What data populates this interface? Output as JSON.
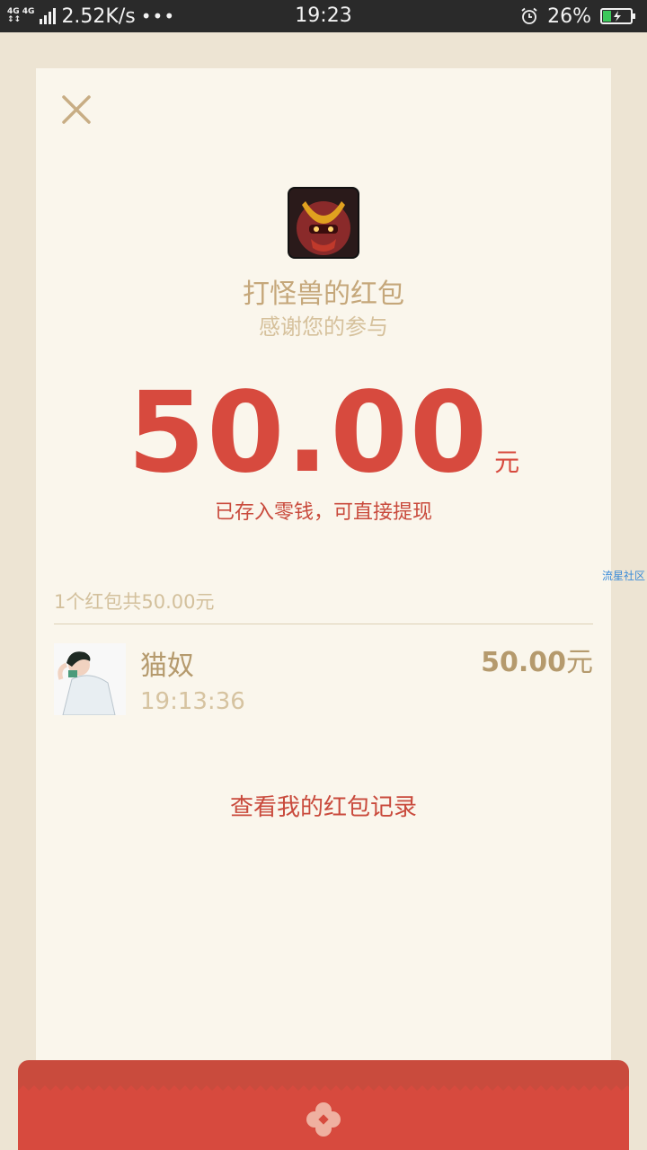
{
  "status_bar": {
    "network_type_top": "4G 4G",
    "network_type_bottom": "↕↕",
    "speed": "2.52K/s",
    "more": "•••",
    "time": "19:23",
    "battery": "26%",
    "icons": [
      "signal-icon",
      "alarm-icon",
      "battery-charging-icon"
    ]
  },
  "close": {
    "icon": "close-icon",
    "color": "#c8ad84"
  },
  "sender": {
    "title": "打怪兽的红包",
    "subtitle": "感谢您的参与"
  },
  "amount": {
    "value": "50.00",
    "unit": "元",
    "note": "已存入零钱，可直接提现"
  },
  "summary": "1个红包共50.00元",
  "records": [
    {
      "name": "猫奴",
      "time": "19:13:36",
      "amount": "50.00",
      "unit": "元"
    }
  ],
  "history_link": "查看我的红包记录",
  "watermark": "流星社区",
  "colors": {
    "accent_red": "#d74a3e",
    "gold": "#c5a77a",
    "card_bg": "#faf6ec",
    "page_bg": "#ede4d3"
  }
}
